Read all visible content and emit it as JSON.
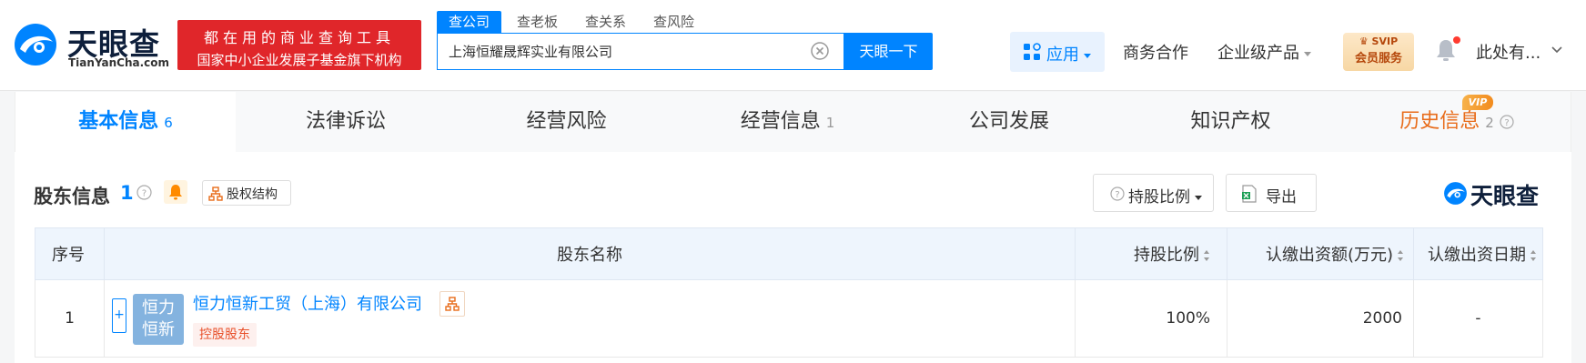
{
  "header": {
    "logo_cn": "天眼查",
    "logo_en": "TianYanCha.com",
    "banner_line1": "都在用的商业查询工具",
    "banner_line2": "国家中小企业发展子基金旗下机构",
    "search_tabs": [
      "查公司",
      "查老板",
      "查关系",
      "查风险"
    ],
    "search_value": "上海恒耀晟辉实业有限公司",
    "search_button": "天眼一下",
    "apps_label": "应用",
    "business": "商务合作",
    "enterprise": "企业级产品",
    "svip_top": "SVIP",
    "svip_bottom": "会员服务",
    "user_name": "此处有..."
  },
  "tabs": [
    {
      "label": "基本信息",
      "count": "6"
    },
    {
      "label": "法律诉讼",
      "count": ""
    },
    {
      "label": "经营风险",
      "count": ""
    },
    {
      "label": "经营信息",
      "count": "1"
    },
    {
      "label": "公司发展",
      "count": ""
    },
    {
      "label": "知识产权",
      "count": ""
    },
    {
      "label": "历史信息",
      "count": "2"
    }
  ],
  "vip_badge": "VIP",
  "section": {
    "title": "股东信息",
    "count": "1",
    "equity_structure": "股权结构",
    "ratio_filter": "持股比例",
    "export": "导出",
    "brand": "天眼查"
  },
  "table": {
    "headers": [
      "序号",
      "股东名称",
      "持股比例",
      "认缴出资额(万元)",
      "认缴出资日期"
    ],
    "rows": [
      {
        "index": "1",
        "avatar_line1": "恒力",
        "avatar_line2": "恒新",
        "name": "恒力恒新工贸（上海）有限公司",
        "tag": "控股股东",
        "ratio": "100%",
        "amount": "2000",
        "date": "-"
      }
    ]
  },
  "colors": {
    "accent": "#0084ff",
    "banner_red": "#e0262a",
    "history_orange": "#e86c1a",
    "tag_red": "#e8502a"
  }
}
